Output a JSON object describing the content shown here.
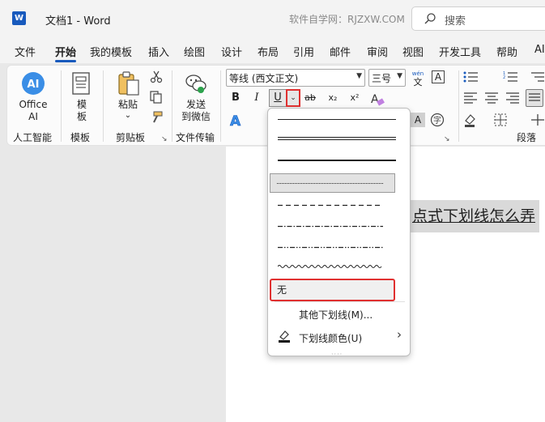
{
  "app": {
    "doc_title": "文档1  -  Word",
    "watermark": "软件自学网：RJZXW.COM",
    "search_placeholder": "搜索"
  },
  "menu": {
    "tabs": [
      "文件",
      "开始",
      "我的模板",
      "插入",
      "绘图",
      "设计",
      "布局",
      "引用",
      "邮件",
      "审阅",
      "视图",
      "开发工具",
      "帮助",
      "AI"
    ],
    "active": "开始"
  },
  "ribbon": {
    "ai": {
      "label_line1": "Office",
      "label_line2": "AI",
      "group": "人工智能"
    },
    "template": {
      "label_line1": "模",
      "label_line2": "板",
      "group": "模板"
    },
    "clipboard": {
      "paste_label": "粘贴",
      "paste_arrow": "⌄",
      "group": "剪贴板"
    },
    "transfer": {
      "label_line1": "发送",
      "label_line2": "到微信",
      "group": "文件传输"
    },
    "font": {
      "font_name": "等线 (西文正文)",
      "font_size": "三号",
      "wen_glyph": "wén",
      "wen_char": "文",
      "a_box": "A",
      "bold": "B",
      "italic": "I",
      "underline": "U",
      "underline_arrow": "⌄",
      "strike": "ab",
      "subscript": "x₂",
      "superscript": "x²"
    },
    "paragraph": {
      "group": "段落"
    },
    "font_expand_icon": "↘"
  },
  "document": {
    "selected_text": "点式下划线怎么弄"
  },
  "underline_menu": {
    "styles": [
      "single",
      "double",
      "thick",
      "dotted",
      "dashed",
      "dash-dot",
      "dash-dot-dot",
      "wave"
    ],
    "selected_style": "dotted",
    "none_label": "无",
    "more_label": "其他下划线(M)...",
    "color_label": "下划线颜色(U)",
    "submenu_arrow": "›",
    "grip": "····"
  },
  "colors": {
    "accent": "#185abd",
    "highlight_red": "#e03030"
  }
}
